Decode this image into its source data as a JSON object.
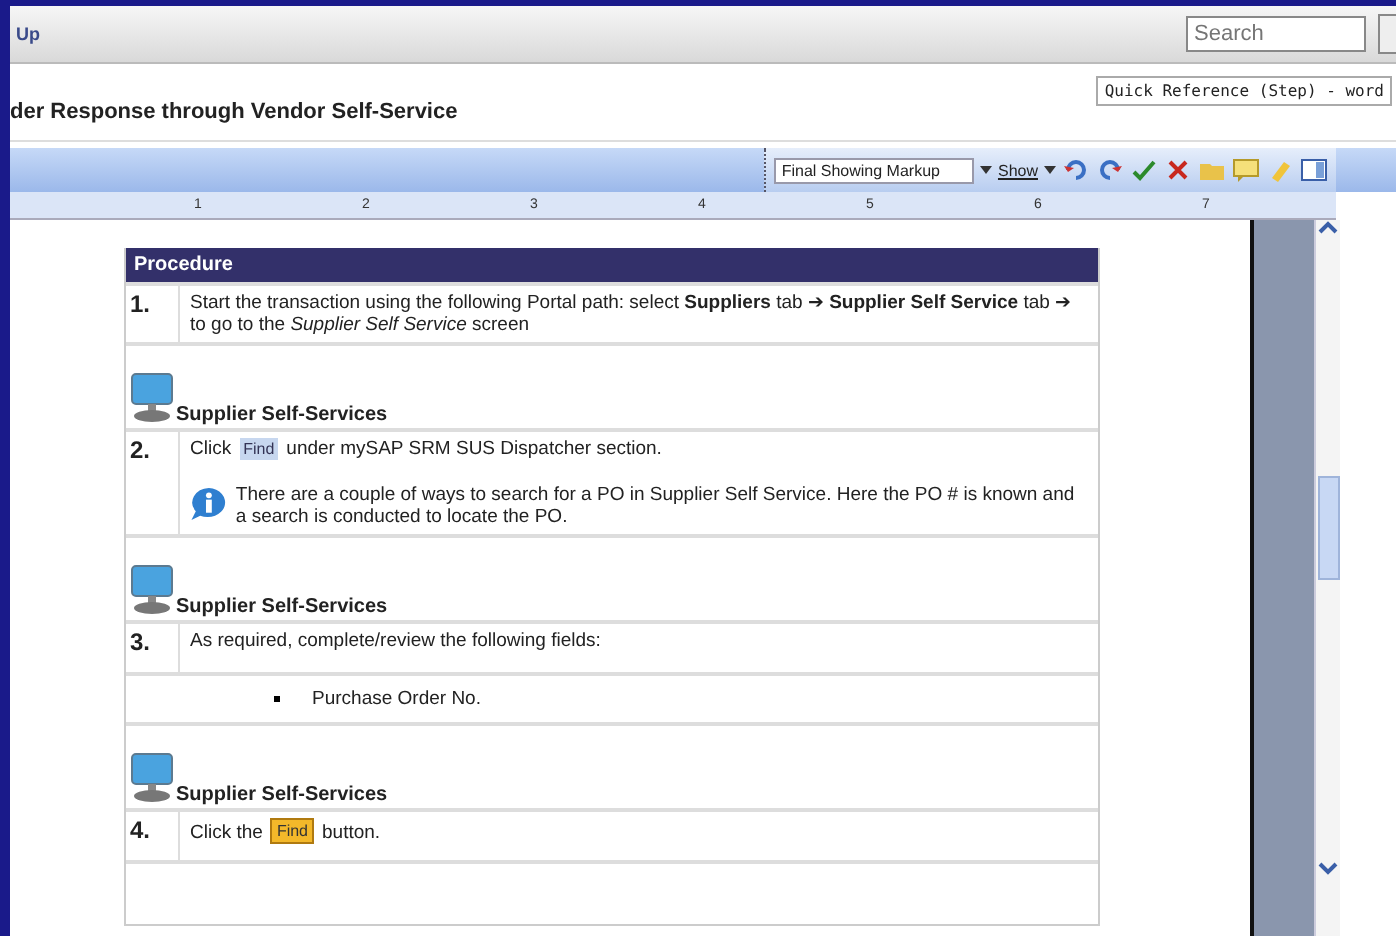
{
  "top_bar": {
    "title": "Up",
    "search": {
      "placeholder": "Search"
    }
  },
  "document_title": "der Response through Vendor Self-Service",
  "quick_reference": "Quick Reference (Step) - word",
  "toolbar": {
    "markup_dropdown": "Final Showing Markup",
    "show_button": "Show"
  },
  "ruler": {
    "numbers": [
      "1",
      "2",
      "3",
      "4",
      "5",
      "6",
      "7"
    ]
  },
  "procedure": {
    "heading": "Procedure",
    "rows": [
      {
        "kind": "step",
        "number": "1.",
        "text": "Start the transaction using the following Portal path: select **Suppliers** tab ➔ **Supplier Self Service** tab ➔  to go to the *Supplier Self Service* screen"
      },
      {
        "kind": "section",
        "title": "Supplier Self-Services"
      },
      {
        "kind": "step",
        "number": "2.",
        "before": "Click",
        "button": {
          "label": "Find",
          "kind": "link"
        },
        "after": "under mySAP SRM SUS Dispatcher section.",
        "note": "There are a couple of ways to search for a PO in Supplier Self Service. Here the PO # is known and a search is conducted to locate the PO."
      },
      {
        "kind": "section",
        "title": "Supplier Self-Services"
      },
      {
        "kind": "step",
        "number": "3.",
        "text": "As required, complete/review the following fields:"
      },
      {
        "kind": "bullet",
        "text": "Purchase Order No."
      },
      {
        "kind": "section",
        "title": "Supplier Self-Services"
      },
      {
        "kind": "step",
        "number": "4.",
        "before": "Click the",
        "button": {
          "label": "Find",
          "kind": "highlighted"
        },
        "after": "button."
      }
    ]
  }
}
